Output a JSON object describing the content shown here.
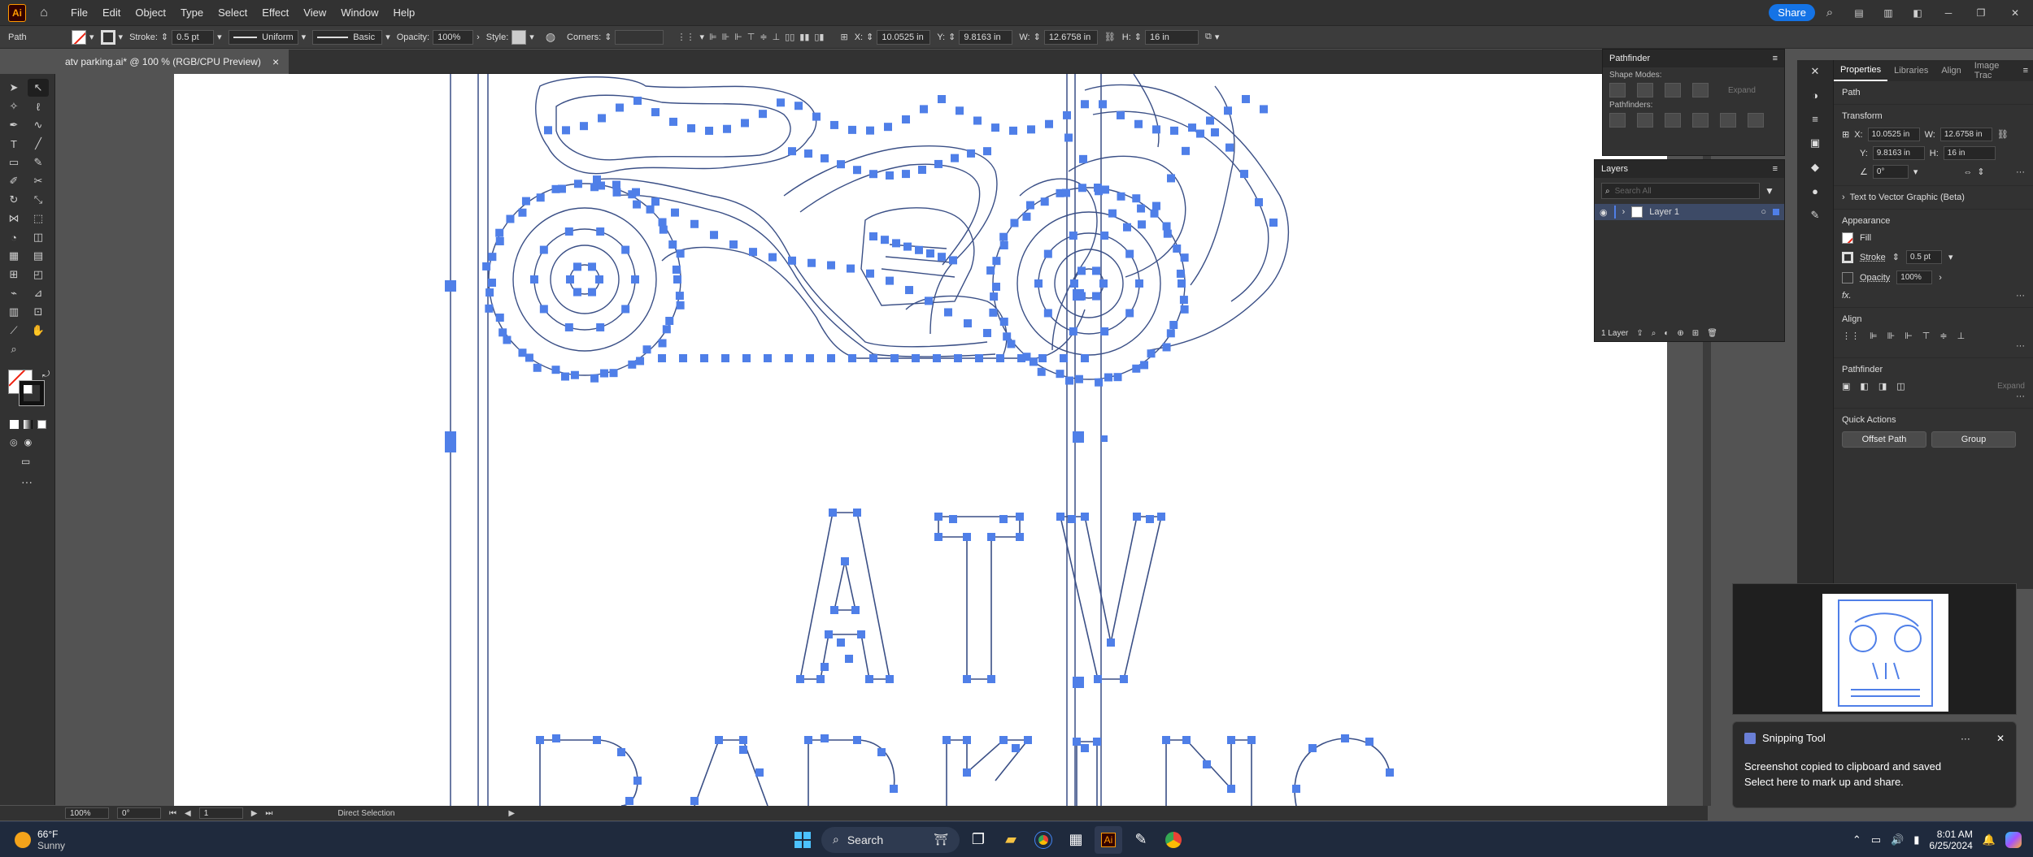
{
  "app": {
    "logo": "Ai",
    "menu": [
      "File",
      "Edit",
      "Object",
      "Type",
      "Select",
      "Effect",
      "View",
      "Window",
      "Help"
    ],
    "share_label": "Share"
  },
  "control_bar": {
    "selection_type": "Path",
    "stroke_label": "Stroke:",
    "stroke_weight": "0.5 pt",
    "stroke_profile": "Uniform",
    "brush": "Basic",
    "opacity_label": "Opacity:",
    "opacity_value": "100%",
    "style_label": "Style:",
    "corners_label": "Corners:",
    "x_label": "X:",
    "x_value": "10.0525 in",
    "y_label": "Y:",
    "y_value": "9.8163 in",
    "w_label": "W:",
    "w_value": "12.6758 in",
    "h_label": "H:",
    "h_value": "16 in"
  },
  "document": {
    "tab_title": "atv parking.ai* @ 100 % (RGB/CPU Preview)",
    "close": "×"
  },
  "artwork": {
    "line1": "ATV",
    "line2": "PARKING",
    "point_color": "#4f7fe8",
    "path_color": "#3a4f86"
  },
  "status_bar": {
    "zoom": "100%",
    "rotation": "0°",
    "artboard_num": "1",
    "tool_name": "Direct Selection"
  },
  "pathfinder_panel": {
    "title": "Pathfinder",
    "shape_modes": "Shape Modes:",
    "expand": "Expand",
    "pathfinders": "Pathfinders:"
  },
  "layers_panel": {
    "title": "Layers",
    "search_placeholder": "Search All",
    "layer_name": "Layer 1",
    "count": "1 Layer"
  },
  "properties_panel": {
    "tabs": [
      "Properties",
      "Libraries",
      "Align",
      "Image Trac"
    ],
    "object_type": "Path",
    "transform_title": "Transform",
    "x_label": "X:",
    "x_value": "10.0525 in",
    "y_label": "Y:",
    "y_value": "9.8163 in",
    "w_label": "W:",
    "w_value": "12.6758 in",
    "h_label": "H:",
    "h_value": "16 in",
    "angle": "0°",
    "text_to_vector": "Text to Vector Graphic (Beta)",
    "appearance_title": "Appearance",
    "fill_label": "Fill",
    "stroke_label": "Stroke",
    "stroke_value": "0.5 pt",
    "opacity_label": "Opacity",
    "opacity_value": "100%",
    "fx": "fx.",
    "align_title": "Align",
    "pathfinder_title": "Pathfinder",
    "expand": "Expand",
    "quick_actions_title": "Quick Actions",
    "offset_path": "Offset Path",
    "group": "Group"
  },
  "notification": {
    "app": "Snipping Tool",
    "line1": "Screenshot copied to clipboard and saved",
    "line2": "Select here to mark up and share.",
    "more": "···",
    "close": "✕"
  },
  "taskbar": {
    "weather_temp": "66°F",
    "weather_desc": "Sunny",
    "search_label": "Search",
    "time": "8:01 AM",
    "date": "6/25/2024"
  }
}
